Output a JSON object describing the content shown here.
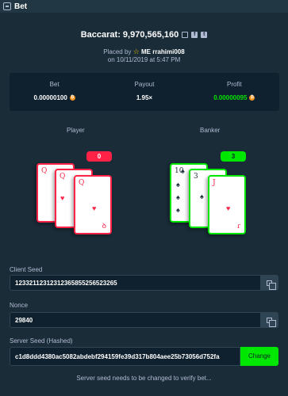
{
  "window": {
    "title": "Bet",
    "icon": "bet-icon"
  },
  "game": {
    "label": "Baccarat: 9,970,565,160"
  },
  "placed": {
    "prefix": "Placed by",
    "user": "ME rrahimi008",
    "date": "on 10/11/2019 at 5:47 PM"
  },
  "stats": {
    "bet": {
      "label": "Bet",
      "value": "0.00000100"
    },
    "payout": {
      "label": "Payout",
      "value": "1.95×"
    },
    "profit": {
      "label": "Profit",
      "value": "0.00000095"
    }
  },
  "player": {
    "label": "Player",
    "score": "0",
    "cards": [
      "Q",
      "Q",
      "Q"
    ]
  },
  "banker": {
    "label": "Banker",
    "score": "3",
    "cards": [
      "10",
      "3",
      "J"
    ]
  },
  "client_seed": {
    "label": "Client Seed",
    "value": "12332112312312365855256523265"
  },
  "nonce": {
    "label": "Nonce",
    "value": "29840"
  },
  "server_seed": {
    "label": "Server Seed (Hashed)",
    "value": "c1d8ddd4380ac5082abdebf294159fe39d317b804aee25b73056d752fa",
    "button": "Change"
  },
  "note": "Server seed needs to be changed to verify bet...",
  "colors": {
    "accent_green": "#00e701",
    "accent_red": "#fe2247",
    "background": "#1a2c38",
    "panel": "#0f212e"
  }
}
